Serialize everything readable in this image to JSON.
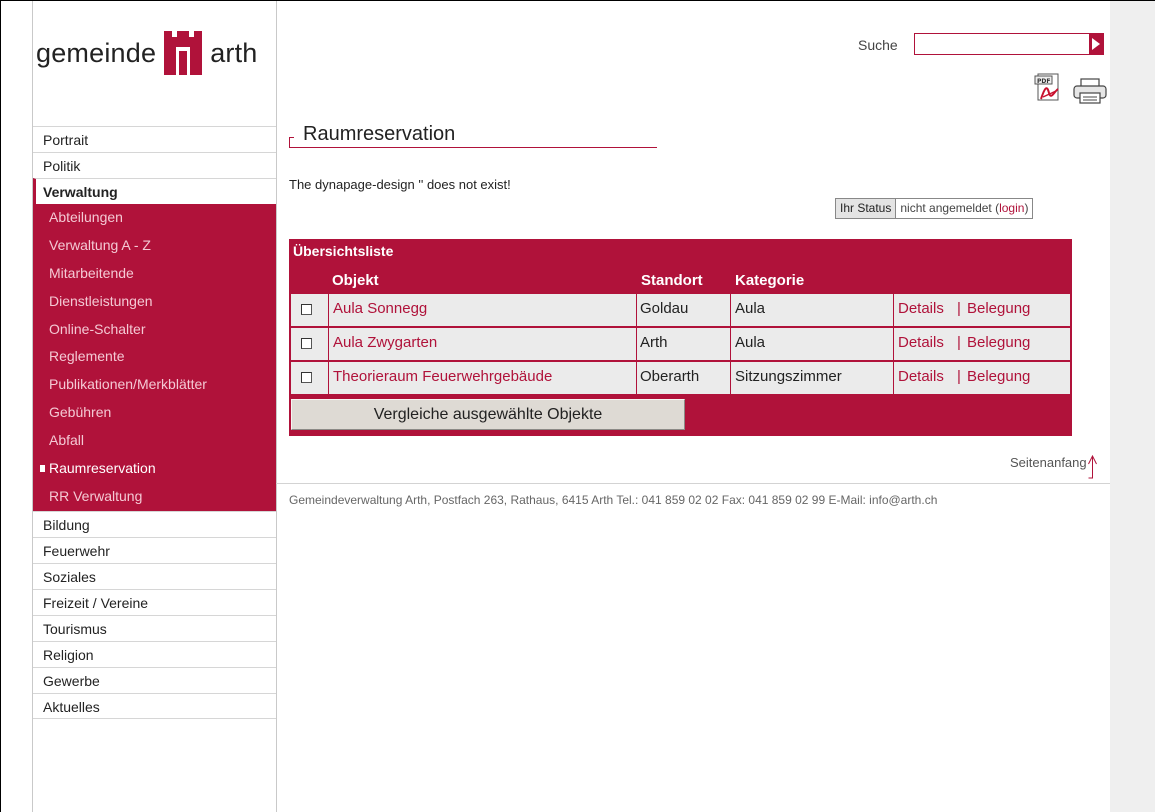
{
  "logo": {
    "word_left": "gemeinde",
    "word_right": "arth"
  },
  "nav": {
    "items_top": [
      {
        "label": "Portrait"
      },
      {
        "label": "Politik"
      },
      {
        "label": "Verwaltung"
      }
    ],
    "subitems": [
      {
        "label": "Abteilungen"
      },
      {
        "label": "Verwaltung A - Z"
      },
      {
        "label": "Mitarbeitende"
      },
      {
        "label": "Dienstleistungen"
      },
      {
        "label": "Online-Schalter"
      },
      {
        "label": "Reglemente"
      },
      {
        "label": "Publikationen/Merkblätter"
      },
      {
        "label": "Gebühren"
      },
      {
        "label": "Abfall"
      },
      {
        "label": "Raumreservation"
      },
      {
        "label": "RR Verwaltung"
      }
    ],
    "items_bottom": [
      {
        "label": "Bildung"
      },
      {
        "label": "Feuerwehr"
      },
      {
        "label": "Soziales"
      },
      {
        "label": "Freizeit / Vereine"
      },
      {
        "label": "Tourismus"
      },
      {
        "label": "Religion"
      },
      {
        "label": "Gewerbe"
      },
      {
        "label": "Aktuelles"
      }
    ]
  },
  "search": {
    "label": "Suche",
    "value": ""
  },
  "icons": {
    "pdf": "pdf-icon",
    "print": "printer-icon"
  },
  "page": {
    "title": "Raumreservation",
    "error": "The dynapage-design '' does not exist!"
  },
  "status": {
    "label": "Ihr Status",
    "value": "nicht angemeldet (",
    "login": "login",
    "close": ")"
  },
  "list": {
    "title": "Übersichtsliste",
    "headers": {
      "objekt": "Objekt",
      "standort": "Standort",
      "kategorie": "Kategorie"
    },
    "rows": [
      {
        "objekt": "Aula Sonnegg",
        "standort": "Goldau",
        "kategorie": "Aula",
        "details": "Details",
        "sep": "|",
        "belegung": "Belegung"
      },
      {
        "objekt": "Aula Zwygarten",
        "standort": "Arth",
        "kategorie": "Aula",
        "details": "Details",
        "sep": "|",
        "belegung": "Belegung"
      },
      {
        "objekt": "Theorieraum Feuerwehrgebäude",
        "standort": "Oberarth",
        "kategorie": "Sitzungszimmer",
        "details": "Details",
        "sep": "|",
        "belegung": "Belegung"
      }
    ],
    "compare_button": "Vergleiche ausgewählte Objekte"
  },
  "top_link": "Seitenanfang",
  "footer": "Gemeindeverwaltung Arth, Postfach 263, Rathaus,  6415 Arth  Tel.: 041 859 02 02  Fax: 041 859 02 99  E-Mail: info@arth.ch",
  "colors": {
    "brand": "#b0123a",
    "row_bg": "#ebebeb",
    "sub_text": "#f4c9d4"
  }
}
